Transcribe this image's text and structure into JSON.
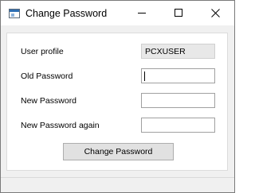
{
  "window": {
    "title": "Change Password",
    "icon": "app-window-icon"
  },
  "controls": {
    "minimize": "minimize-icon",
    "maximize": "maximize-icon",
    "close": "close-icon"
  },
  "form": {
    "user_profile_label": "User profile",
    "user_profile_value": "PCXUSER",
    "old_password_label": "Old Password",
    "old_password_value": "",
    "new_password_label": "New Password",
    "new_password_value": "",
    "new_password_again_label": "New Password again",
    "new_password_again_value": "",
    "submit_label": "Change Password"
  },
  "colors": {
    "window_bg": "#f0f0f0",
    "panel_bg": "#ffffff",
    "readonly_field_bg": "#e8e8e8",
    "button_bg": "#e1e1e1"
  }
}
